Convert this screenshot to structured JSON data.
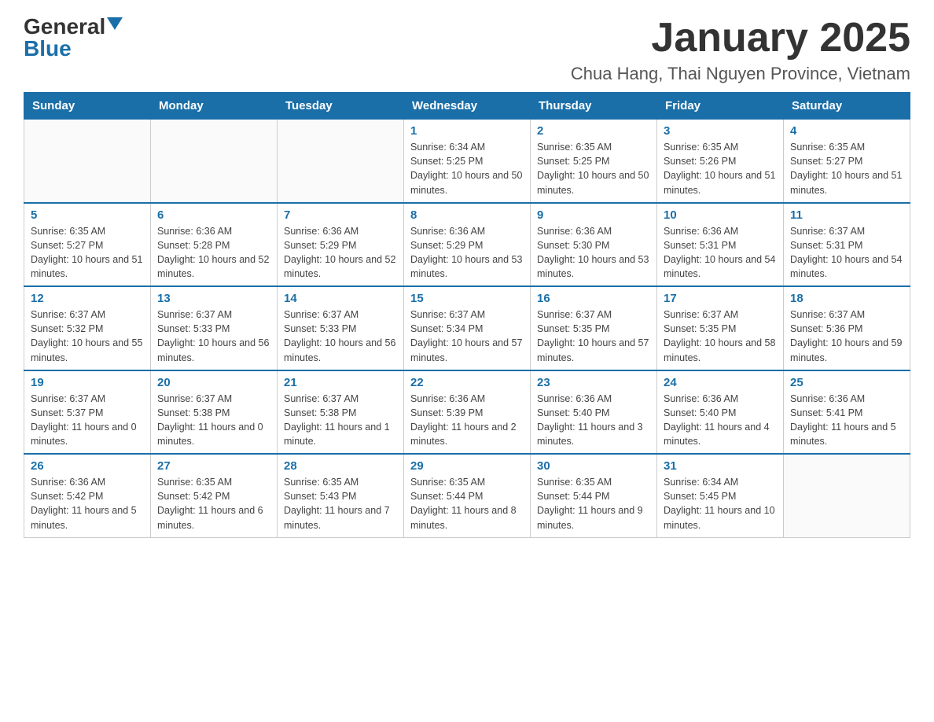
{
  "logo": {
    "general": "General",
    "blue": "Blue"
  },
  "title": "January 2025",
  "subtitle": "Chua Hang, Thai Nguyen Province, Vietnam",
  "weekdays": [
    "Sunday",
    "Monday",
    "Tuesday",
    "Wednesday",
    "Thursday",
    "Friday",
    "Saturday"
  ],
  "weeks": [
    [
      {
        "day": "",
        "info": ""
      },
      {
        "day": "",
        "info": ""
      },
      {
        "day": "",
        "info": ""
      },
      {
        "day": "1",
        "info": "Sunrise: 6:34 AM\nSunset: 5:25 PM\nDaylight: 10 hours and 50 minutes."
      },
      {
        "day": "2",
        "info": "Sunrise: 6:35 AM\nSunset: 5:25 PM\nDaylight: 10 hours and 50 minutes."
      },
      {
        "day": "3",
        "info": "Sunrise: 6:35 AM\nSunset: 5:26 PM\nDaylight: 10 hours and 51 minutes."
      },
      {
        "day": "4",
        "info": "Sunrise: 6:35 AM\nSunset: 5:27 PM\nDaylight: 10 hours and 51 minutes."
      }
    ],
    [
      {
        "day": "5",
        "info": "Sunrise: 6:35 AM\nSunset: 5:27 PM\nDaylight: 10 hours and 51 minutes."
      },
      {
        "day": "6",
        "info": "Sunrise: 6:36 AM\nSunset: 5:28 PM\nDaylight: 10 hours and 52 minutes."
      },
      {
        "day": "7",
        "info": "Sunrise: 6:36 AM\nSunset: 5:29 PM\nDaylight: 10 hours and 52 minutes."
      },
      {
        "day": "8",
        "info": "Sunrise: 6:36 AM\nSunset: 5:29 PM\nDaylight: 10 hours and 53 minutes."
      },
      {
        "day": "9",
        "info": "Sunrise: 6:36 AM\nSunset: 5:30 PM\nDaylight: 10 hours and 53 minutes."
      },
      {
        "day": "10",
        "info": "Sunrise: 6:36 AM\nSunset: 5:31 PM\nDaylight: 10 hours and 54 minutes."
      },
      {
        "day": "11",
        "info": "Sunrise: 6:37 AM\nSunset: 5:31 PM\nDaylight: 10 hours and 54 minutes."
      }
    ],
    [
      {
        "day": "12",
        "info": "Sunrise: 6:37 AM\nSunset: 5:32 PM\nDaylight: 10 hours and 55 minutes."
      },
      {
        "day": "13",
        "info": "Sunrise: 6:37 AM\nSunset: 5:33 PM\nDaylight: 10 hours and 56 minutes."
      },
      {
        "day": "14",
        "info": "Sunrise: 6:37 AM\nSunset: 5:33 PM\nDaylight: 10 hours and 56 minutes."
      },
      {
        "day": "15",
        "info": "Sunrise: 6:37 AM\nSunset: 5:34 PM\nDaylight: 10 hours and 57 minutes."
      },
      {
        "day": "16",
        "info": "Sunrise: 6:37 AM\nSunset: 5:35 PM\nDaylight: 10 hours and 57 minutes."
      },
      {
        "day": "17",
        "info": "Sunrise: 6:37 AM\nSunset: 5:35 PM\nDaylight: 10 hours and 58 minutes."
      },
      {
        "day": "18",
        "info": "Sunrise: 6:37 AM\nSunset: 5:36 PM\nDaylight: 10 hours and 59 minutes."
      }
    ],
    [
      {
        "day": "19",
        "info": "Sunrise: 6:37 AM\nSunset: 5:37 PM\nDaylight: 11 hours and 0 minutes."
      },
      {
        "day": "20",
        "info": "Sunrise: 6:37 AM\nSunset: 5:38 PM\nDaylight: 11 hours and 0 minutes."
      },
      {
        "day": "21",
        "info": "Sunrise: 6:37 AM\nSunset: 5:38 PM\nDaylight: 11 hours and 1 minute."
      },
      {
        "day": "22",
        "info": "Sunrise: 6:36 AM\nSunset: 5:39 PM\nDaylight: 11 hours and 2 minutes."
      },
      {
        "day": "23",
        "info": "Sunrise: 6:36 AM\nSunset: 5:40 PM\nDaylight: 11 hours and 3 minutes."
      },
      {
        "day": "24",
        "info": "Sunrise: 6:36 AM\nSunset: 5:40 PM\nDaylight: 11 hours and 4 minutes."
      },
      {
        "day": "25",
        "info": "Sunrise: 6:36 AM\nSunset: 5:41 PM\nDaylight: 11 hours and 5 minutes."
      }
    ],
    [
      {
        "day": "26",
        "info": "Sunrise: 6:36 AM\nSunset: 5:42 PM\nDaylight: 11 hours and 5 minutes."
      },
      {
        "day": "27",
        "info": "Sunrise: 6:35 AM\nSunset: 5:42 PM\nDaylight: 11 hours and 6 minutes."
      },
      {
        "day": "28",
        "info": "Sunrise: 6:35 AM\nSunset: 5:43 PM\nDaylight: 11 hours and 7 minutes."
      },
      {
        "day": "29",
        "info": "Sunrise: 6:35 AM\nSunset: 5:44 PM\nDaylight: 11 hours and 8 minutes."
      },
      {
        "day": "30",
        "info": "Sunrise: 6:35 AM\nSunset: 5:44 PM\nDaylight: 11 hours and 9 minutes."
      },
      {
        "day": "31",
        "info": "Sunrise: 6:34 AM\nSunset: 5:45 PM\nDaylight: 11 hours and 10 minutes."
      },
      {
        "day": "",
        "info": ""
      }
    ]
  ]
}
